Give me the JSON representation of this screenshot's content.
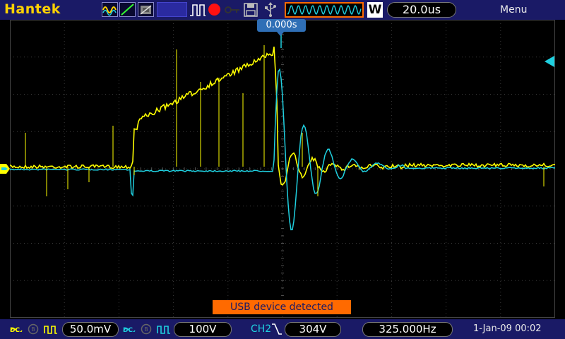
{
  "header": {
    "brand": "Hantek",
    "timebase": "20.0us",
    "timebase_mode": "W",
    "menu_label": "Menu",
    "icons": [
      "acquire-mode-icon",
      "display-mode-icon",
      "persistence-icon",
      "pulse-trigger-icon",
      "record-icon",
      "key-icon",
      "save-icon",
      "usb-icon"
    ]
  },
  "trigger_position": "0.000s",
  "toast": "USB device detected",
  "footer": {
    "ch1": {
      "coupling": "DC",
      "scale": "50.0mV"
    },
    "ch2": {
      "coupling": "DC",
      "scale": "100V"
    },
    "trigger": {
      "source": "CH2",
      "edge": "falling",
      "level": "304V"
    },
    "frequency": "325.000Hz",
    "datetime": "1-Jan-09 00:02"
  },
  "colors": {
    "ch1": "#ffff00",
    "ch2": "#1fd0e0",
    "bar_background": "#1a1a66",
    "accent": "#ff6a00",
    "brand": "#ffd200"
  }
}
